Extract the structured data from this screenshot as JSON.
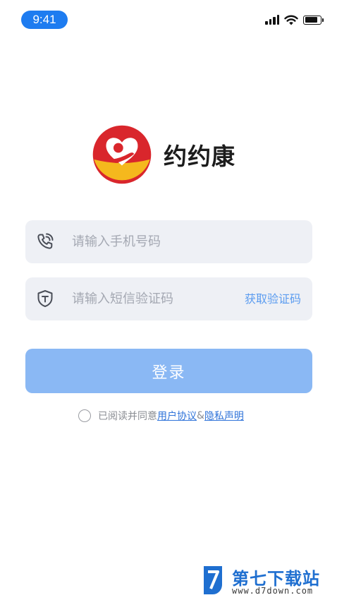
{
  "status_bar": {
    "time": "9:41",
    "signal_icon": "cellular-signal-icon",
    "wifi_icon": "wifi-icon",
    "battery_icon": "battery-icon",
    "battery_level": 0.85
  },
  "app": {
    "name": "约约康",
    "logo_icon": "heart-hand-logo-icon"
  },
  "login_form": {
    "phone": {
      "icon": "phone-icon",
      "placeholder": "请输入手机号码",
      "value": ""
    },
    "code": {
      "icon": "shield-icon",
      "placeholder": "请输入短信验证码",
      "value": "",
      "get_code_label": "获取验证码"
    },
    "login_label": "登录",
    "agreement": {
      "checked": false,
      "prefix": "已阅读并同意",
      "user_agreement_label": "用户协议",
      "connector": "&",
      "privacy_label": "隐私声明"
    }
  },
  "watermark": {
    "title": "第七下载站",
    "url": "www.d7down.com"
  },
  "colors": {
    "accent": "#1e7cf0",
    "button_disabled": "#8ab8f4",
    "link": "#2f73d9",
    "field_bg": "#eef0f5",
    "logo_red": "#d9262c",
    "logo_yellow": "#f5b81d"
  }
}
